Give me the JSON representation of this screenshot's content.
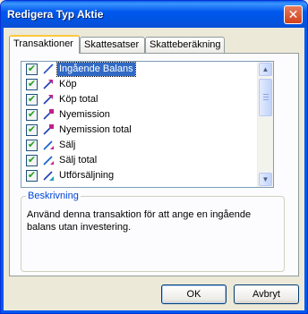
{
  "window": {
    "title": "Redigera Typ Aktie",
    "close_glyph": "✕"
  },
  "tabs": [
    {
      "label": "Transaktioner",
      "active": true
    },
    {
      "label": "Skattesatser",
      "active": false
    },
    {
      "label": "Skatteberäkning",
      "active": false
    }
  ],
  "transactions": {
    "items": [
      {
        "label": "Ingående Balans",
        "checked": true,
        "selected": true,
        "icon": "diagonal-line-icon",
        "icon_color": "#2b4fc0"
      },
      {
        "label": "Köp",
        "checked": true,
        "selected": false,
        "icon": "buy-arrow-icon",
        "icon_color": "#c0208c"
      },
      {
        "label": "Köp total",
        "checked": true,
        "selected": false,
        "icon": "buy-arrow-icon",
        "icon_color": "#c0208c"
      },
      {
        "label": "Nyemission",
        "checked": true,
        "selected": false,
        "icon": "new-issue-icon",
        "icon_color": "#c0208c"
      },
      {
        "label": "Nyemission total",
        "checked": true,
        "selected": false,
        "icon": "new-issue-icon",
        "icon_color": "#c0208c"
      },
      {
        "label": "Sälj",
        "checked": true,
        "selected": false,
        "icon": "sell-arrow-icon",
        "icon_color": "#1060d0"
      },
      {
        "label": "Sälj total",
        "checked": true,
        "selected": false,
        "icon": "sell-arrow-icon",
        "icon_color": "#1060d0"
      },
      {
        "label": "Utförsäljning",
        "checked": true,
        "selected": false,
        "icon": "sellout-icon",
        "icon_color": "#20a0c0"
      }
    ],
    "check_glyph": "✔"
  },
  "description": {
    "legend": "Beskrivning",
    "text": "Använd denna transaktion för att ange en ingående balans utan investering."
  },
  "buttons": {
    "ok": "OK",
    "cancel": "Avbryt"
  },
  "colors": {
    "selection": "#316ac5",
    "titlebar": "#0054e3",
    "legend": "#0046d5"
  }
}
